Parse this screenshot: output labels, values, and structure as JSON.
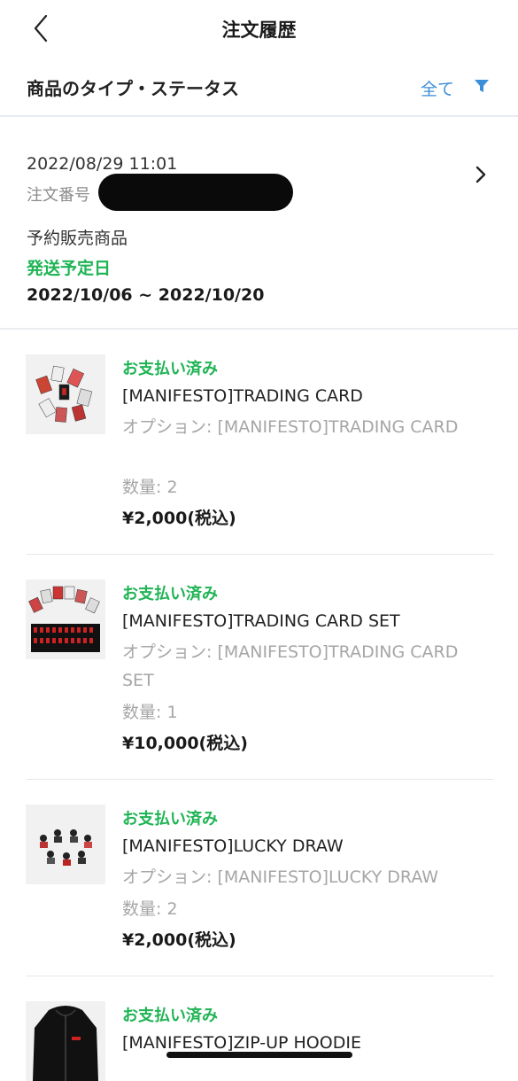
{
  "header": {
    "title": "注文履歴"
  },
  "filter": {
    "label": "商品のタイプ・ステータス",
    "value": "全て"
  },
  "order": {
    "date": "2022/08/29 11:01",
    "number_label": "注文番号",
    "preorder_label": "予約販売商品",
    "ship_label": "発送予定日",
    "ship_range": "2022/10/06 ~ 2022/10/20"
  },
  "items": [
    {
      "status": "お支払い済み",
      "name": "[MANIFESTO]TRADING CARD",
      "option": "オプション: [MANIFESTO]TRADING CARD",
      "qty": "数量: 2",
      "price": "¥2,000(税込)"
    },
    {
      "status": "お支払い済み",
      "name": "[MANIFESTO]TRADING CARD SET",
      "option": "オプション: [MANIFESTO]TRADING CARD SET",
      "qty": "数量: 1",
      "price": "¥10,000(税込)"
    },
    {
      "status": "お支払い済み",
      "name": "[MANIFESTO]LUCKY DRAW",
      "option": "オプション: [MANIFESTO]LUCKY DRAW",
      "qty": "数量: 2",
      "price": "¥2,000(税込)"
    },
    {
      "status": "お支払い済み",
      "name": "[MANIFESTO]ZIP-UP HOODIE"
    }
  ],
  "colors": {
    "accent_green": "#1fb454",
    "link_blue": "#3b8ed8"
  }
}
